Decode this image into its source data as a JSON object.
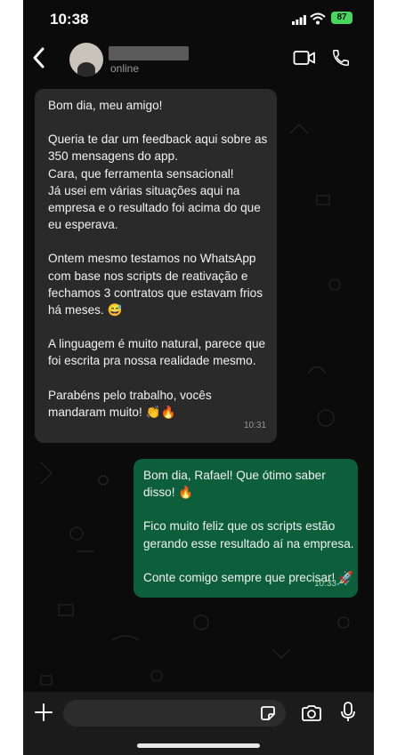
{
  "status_bar": {
    "time": "10:38",
    "battery": "87"
  },
  "header": {
    "contact_status": "online"
  },
  "messages": {
    "incoming": {
      "lines": [
        "Bom dia, meu amigo!",
        "Queria te dar um feedback aqui sobre as 350 mensagens do app.\nCara, que ferramenta sensacional!\nJá usei em várias situações aqui na empresa e o resultado foi acima do que eu esperava.",
        "Ontem mesmo testamos no WhatsApp com base nos scripts de reativação e fechamos 3 contratos que estavam frios há meses. 😅",
        "A linguagem é muito natural, parece que foi escrita pra nossa realidade mesmo.",
        "Parabéns pelo trabalho, vocês mandaram muito! 👏🔥"
      ],
      "time": "10:31"
    },
    "outgoing": {
      "lines": [
        "Bom dia, Rafael! Que ótimo saber disso! 🔥",
        "Fico muito feliz que os scripts estão gerando esse resultado aí na empresa.",
        "Conte comigo sempre que precisar! 🚀"
      ],
      "time": "10:33"
    }
  },
  "composer": {
    "placeholder": ""
  },
  "icons": [
    "back-icon",
    "video-call-icon",
    "phone-icon",
    "plus-icon",
    "sticker-icon",
    "camera-icon",
    "mic-icon"
  ]
}
